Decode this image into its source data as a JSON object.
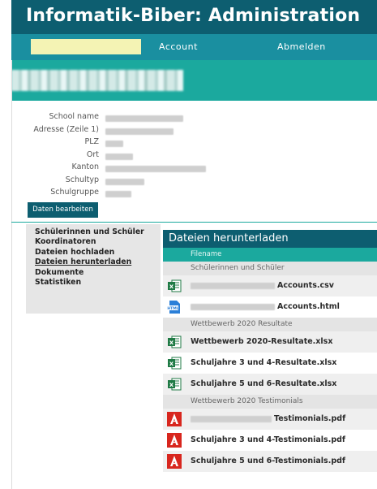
{
  "header": {
    "title": "Informatik-Biber: Administration"
  },
  "nav": {
    "account_label": "Account",
    "logout_label": "Abmelden"
  },
  "school_details": {
    "fields": [
      {
        "label": "School name"
      },
      {
        "label": "Adresse (Zeile 1)"
      },
      {
        "label": "PLZ"
      },
      {
        "label": "Ort"
      },
      {
        "label": "Kanton"
      },
      {
        "label": "Schultyp"
      },
      {
        "label": "Schulgruppe"
      }
    ],
    "edit_button_label": "Daten bearbeiten"
  },
  "sidebar": {
    "items": [
      {
        "label": "Schülerinnen und Schüler",
        "active": false
      },
      {
        "label": "Koordinatoren",
        "active": false
      },
      {
        "label": "Dateien hochladen",
        "active": false
      },
      {
        "label": "Dateien herunterladen",
        "active": true
      },
      {
        "label": "Dokumente",
        "active": false
      },
      {
        "label": "Statistiken",
        "active": false
      }
    ]
  },
  "downloads": {
    "title": "Dateien herunterladen",
    "column_header": "Filename",
    "groups": [
      {
        "label": "Schülerinnen und Schüler",
        "files": [
          {
            "name": "Accounts.csv",
            "icon": "excel-icon"
          },
          {
            "name": "Accounts.html",
            "icon": "html-file-icon"
          }
        ]
      },
      {
        "label": "Wettbewerb 2020 Resultate",
        "files": [
          {
            "name": "Wettbewerb 2020-Resultate.xlsx",
            "icon": "excel-icon"
          },
          {
            "name": "Schuljahre 3 und 4-Resultate.xlsx",
            "icon": "excel-icon"
          },
          {
            "name": "Schuljahre 5 und 6-Resultate.xlsx",
            "icon": "excel-icon"
          }
        ]
      },
      {
        "label": "Wettbewerb 2020 Testimonials",
        "files": [
          {
            "name": "Testimonials.pdf",
            "icon": "pdf-icon"
          },
          {
            "name": "Schuljahre 3 und 4-Testimonials.pdf",
            "icon": "pdf-icon"
          },
          {
            "name": "Schuljahre 5 und 6-Testimonials.pdf",
            "icon": "pdf-icon"
          }
        ]
      }
    ]
  },
  "colors": {
    "dark_teal": "#0d5e70",
    "mid_teal": "#1a8fa0",
    "accent_teal": "#1ba99e",
    "excel_green": "#1f7a45",
    "pdf_red": "#d8261e",
    "html_blue": "#2b7fd8"
  }
}
